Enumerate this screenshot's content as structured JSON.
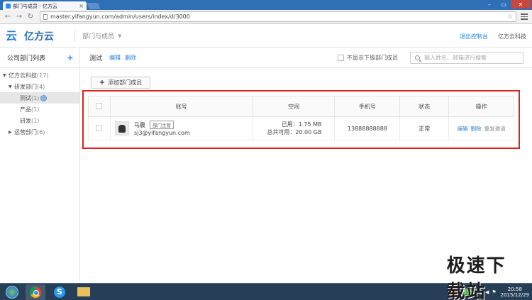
{
  "browser": {
    "tab_title": "部门与成员 - 亿方云",
    "url": "master.yifangyun.com/admin/users/index/d/3000"
  },
  "header": {
    "logo_text": "亿方云",
    "nav_label": "部门与成员",
    "exit_label": "退出控制台",
    "company": "亿方云科技"
  },
  "sidebar": {
    "title": "公司部门列表",
    "add_label": "+",
    "tree": [
      {
        "label": "亿方云科技",
        "count": "(17)",
        "level": 0,
        "expanded": true
      },
      {
        "label": "研发部门",
        "count": "(4)",
        "level": 1,
        "expanded": true
      },
      {
        "label": "测试",
        "count": "(1)",
        "level": 2,
        "active": true
      },
      {
        "label": "产品",
        "count": "(1)",
        "level": 2
      },
      {
        "label": "研发",
        "count": "(1)",
        "level": 2
      },
      {
        "label": "运营部门",
        "count": "(6)",
        "level": 1,
        "expanded": false
      }
    ]
  },
  "main": {
    "dept_name": "测试",
    "edit_label": "编辑",
    "delete_label": "删除",
    "hide_sub_label": "不显示下级部门成员",
    "search_placeholder": "输入姓名、邮箱进行搜索",
    "add_member_label": "添加部门成员",
    "columns": [
      "账号",
      "空间",
      "手机号",
      "状态",
      "操作"
    ],
    "rows": [
      {
        "name": "马晨",
        "badge": "部门主管",
        "email": "sj3@yifangyun.com",
        "used": "已用：1.75 MB",
        "total": "总共可用：20.00 GB",
        "phone": "13888888888",
        "status": "正常",
        "op_edit": "编辑",
        "op_delete": "删除",
        "op_reset": "重发邀请"
      }
    ]
  },
  "taskbar": {
    "watermark": "极速下载站",
    "battery": "55%",
    "time": "20:58",
    "date": "2015/12/29"
  },
  "colors": {
    "accent": "#2a82d9",
    "highlight_border": "#e02020",
    "chrome_blue": "#2f6fb6"
  }
}
